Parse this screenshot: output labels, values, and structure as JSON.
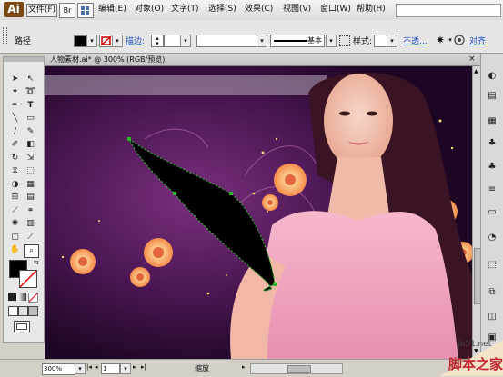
{
  "app": {
    "logo": "Ai"
  },
  "menubar": {
    "file_btn": "文件(F)",
    "br_icon": "Br",
    "items": [
      "编辑(E)",
      "对象(O)",
      "文字(T)",
      "选择(S)",
      "效果(C)",
      "视图(V)",
      "窗口(W)",
      "帮助(H)"
    ]
  },
  "control_bar": {
    "object_type": "路径",
    "stroke_label": "描边:",
    "brush_value": "基本",
    "style_label": "样式:",
    "opacity_label": "不透...",
    "align_label": "对齐"
  },
  "document": {
    "tab_title": "人物素材.ai* @ 300% (RGB/预览)"
  },
  "status": {
    "zoom": "300%",
    "page": "1",
    "mode": "缩放"
  },
  "watermark": {
    "site": "jb51.net",
    "brand": "脚本之家"
  },
  "colors": {
    "fill": "#000000",
    "stroke": "none",
    "path_anchor": "#2db52d"
  }
}
